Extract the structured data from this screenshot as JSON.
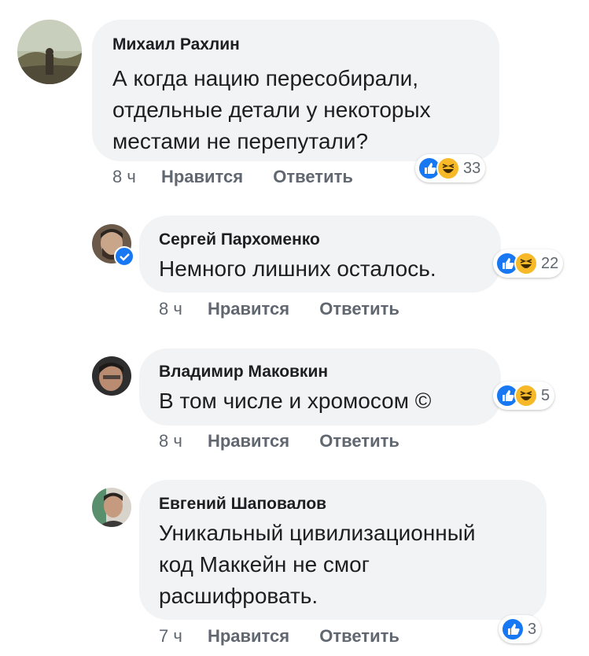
{
  "comments": [
    {
      "author": "Михаил Рахлин",
      "lines": [
        "А когда нацию пересобирали,",
        "отдельные детали у некоторых",
        "местами не перепутали?"
      ],
      "time": "8 ч",
      "like": "Нравится",
      "reply": "Ответить",
      "reactions": {
        "icons": [
          "like-icon",
          "haha-icon"
        ],
        "count": "33"
      }
    },
    {
      "author": "Сергей Пархоменко",
      "lines": [
        "Немного лишних осталось."
      ],
      "verified": true,
      "time": "8 ч",
      "like": "Нравится",
      "reply": "Ответить",
      "reactions": {
        "icons": [
          "like-icon",
          "haha-icon"
        ],
        "count": "22"
      }
    },
    {
      "author": "Владимир Маковкин",
      "lines": [
        "В том числе и хромосом ©"
      ],
      "time": "8 ч",
      "like": "Нравится",
      "reply": "Ответить",
      "reactions": {
        "icons": [
          "like-icon",
          "haha-icon"
        ],
        "count": "5"
      }
    },
    {
      "author": "Евгений Шаповалов",
      "lines": [
        "Уникальный цивилизационный",
        "код Маккейн не смог",
        "расшифровать."
      ],
      "time": "7 ч",
      "like": "Нравится",
      "reply": "Ответить",
      "reactions": {
        "icons": [
          "like-icon"
        ],
        "count": "3"
      }
    }
  ],
  "colors": {
    "like": "#1877f2",
    "haha": "#f7b928",
    "bubble": "#f2f3f5",
    "meta": "#606770"
  }
}
